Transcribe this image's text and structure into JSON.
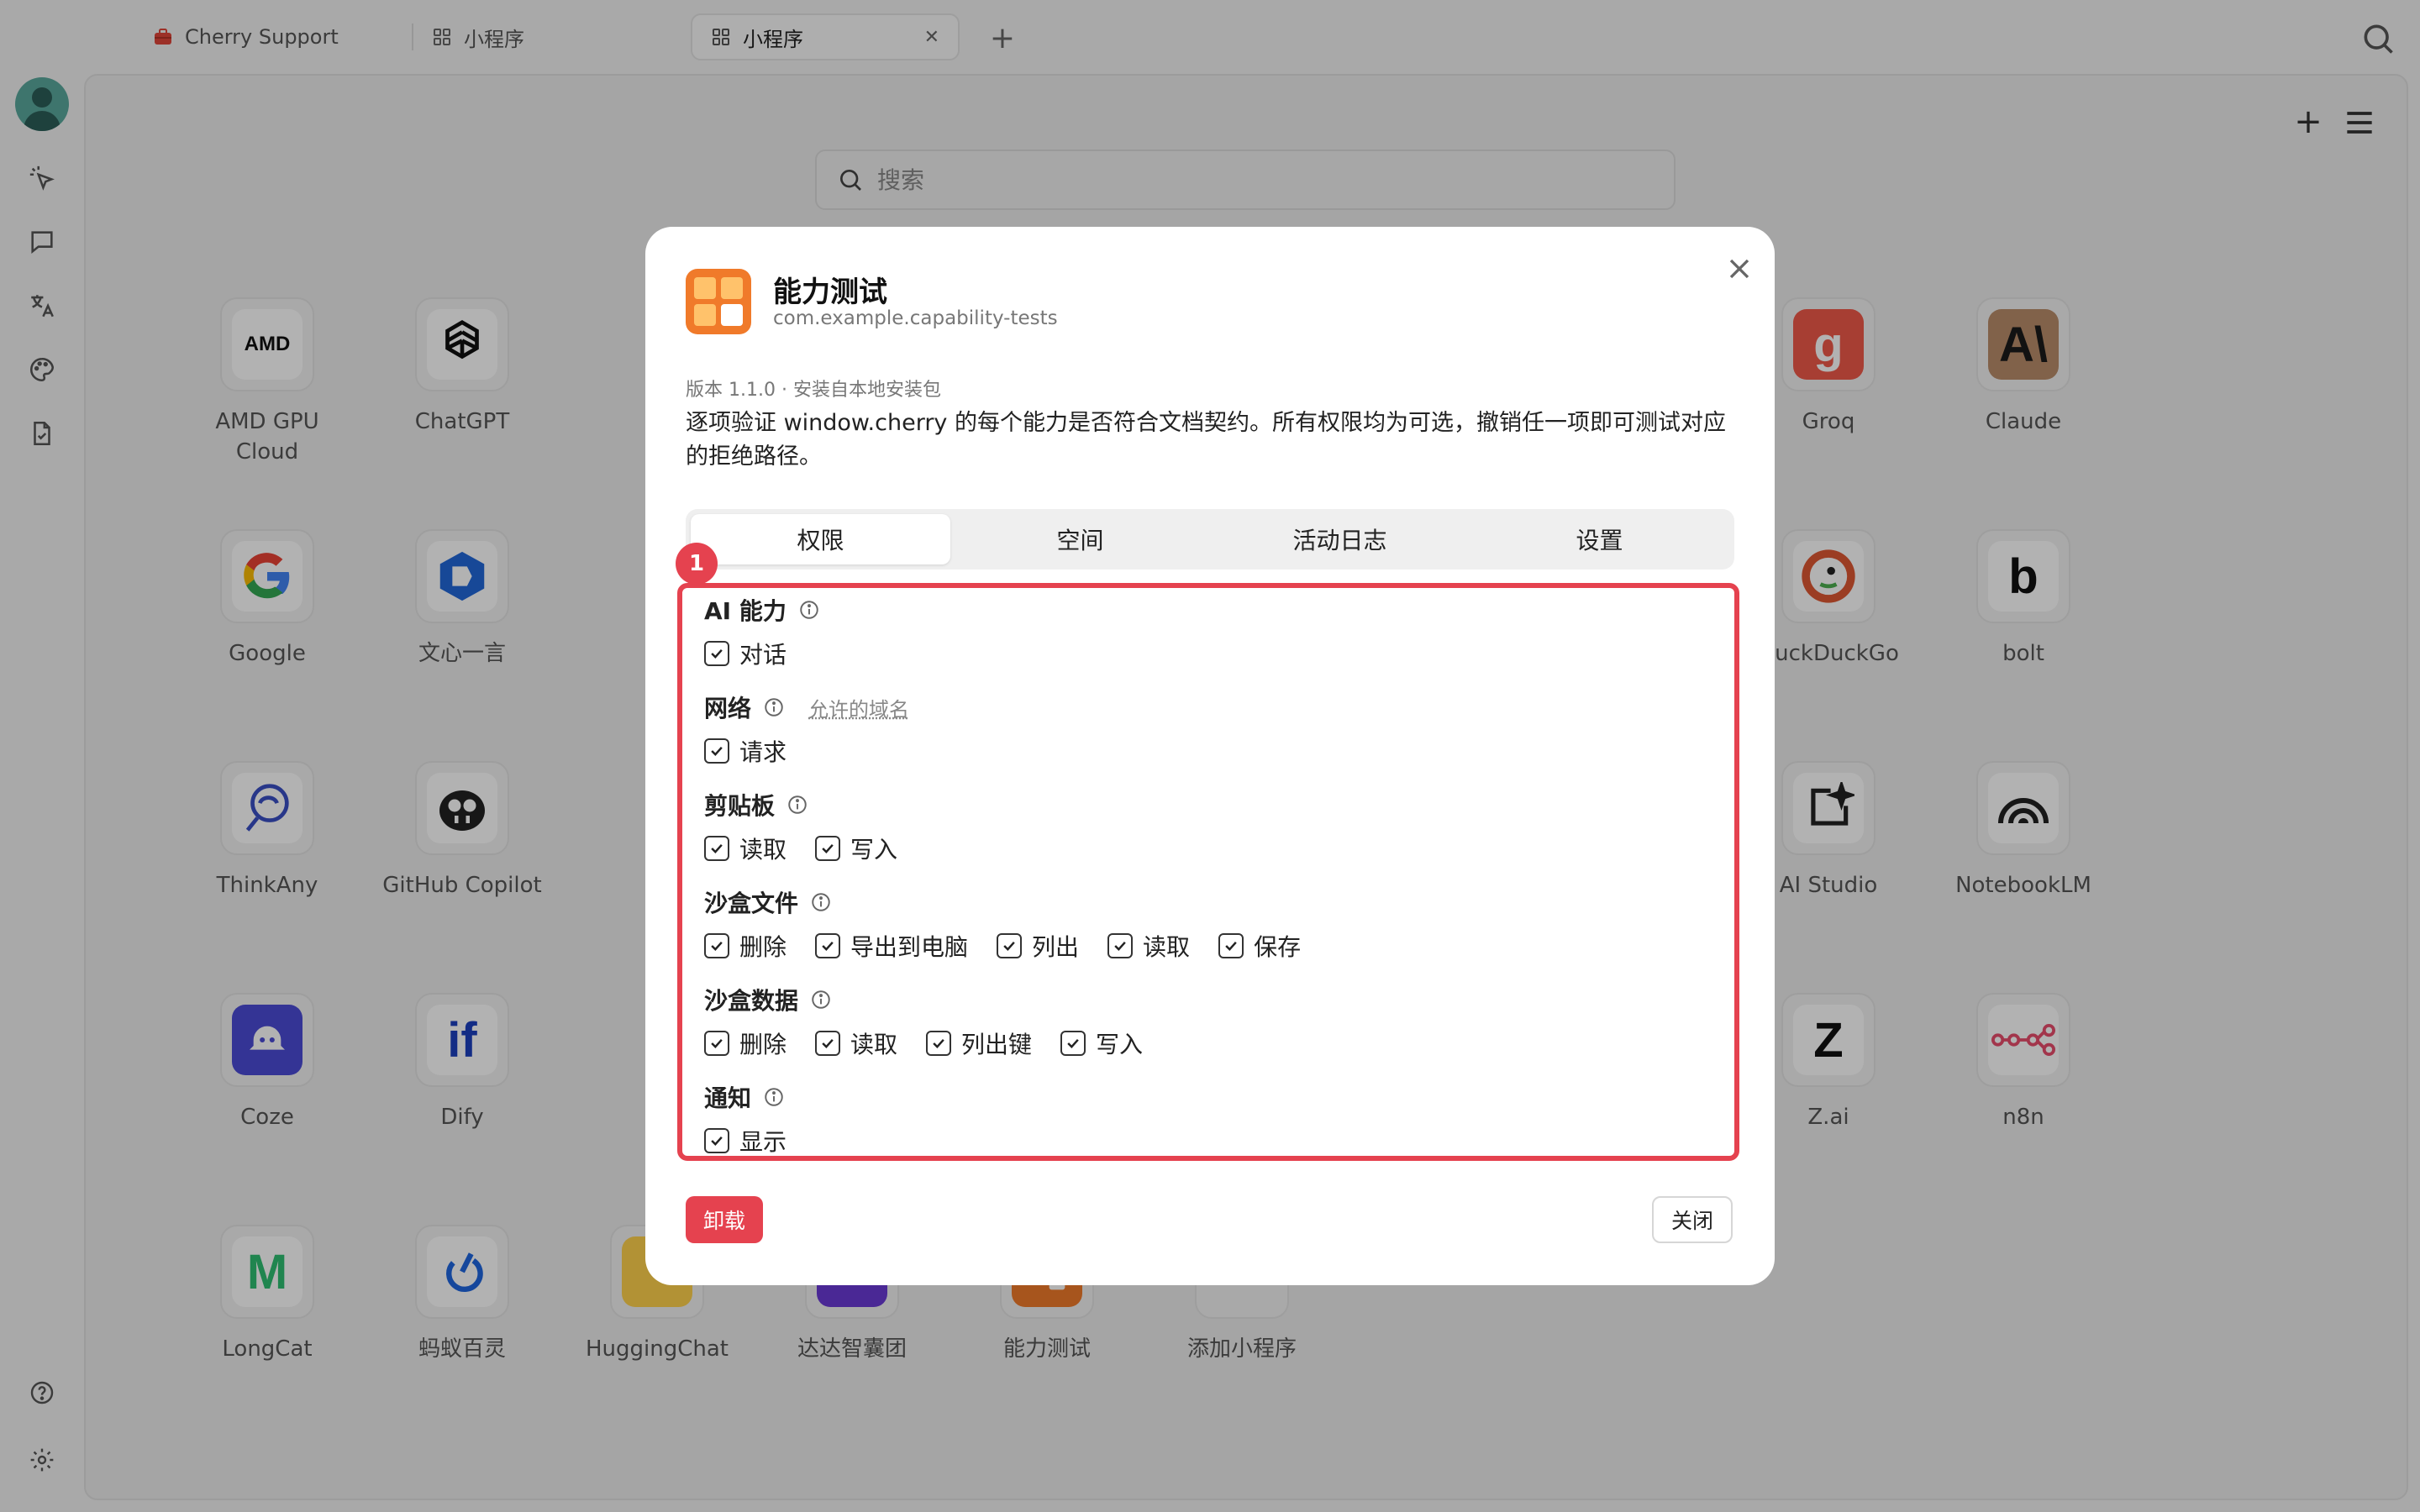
{
  "tabs": [
    {
      "label": "Cherry Support",
      "icon": "briefcase-icon"
    },
    {
      "label": "小程序",
      "icon": "grid-icon"
    },
    {
      "label": "小程序",
      "icon": "grid-icon",
      "active": true
    }
  ],
  "search": {
    "placeholder": "搜索"
  },
  "apps": [
    {
      "name": "AMD GPU Cloud",
      "mark": "AMD",
      "bg": "#ffffff",
      "fg": "#111111"
    },
    {
      "name": "ChatGPT",
      "mark": "",
      "bg": "#ffffff",
      "fg": "#111111"
    },
    {
      "name": "Groq",
      "mark": "g",
      "bg": "#f05a4a",
      "fg": "#ffffff"
    },
    {
      "name": "Claude",
      "mark": "A\\",
      "bg": "#b98d6a",
      "fg": "#1a1a1a"
    },
    {
      "name": "Google",
      "mark": "G",
      "bg": "#ffffff",
      "fg": "#4285f4"
    },
    {
      "name": "文心一言",
      "mark": "",
      "bg": "#ffffff",
      "fg": "#2267d8"
    },
    {
      "name": "DuckDuckGo",
      "mark": "",
      "bg": "#ffffff",
      "fg": "#de5833"
    },
    {
      "name": "bolt",
      "mark": "b",
      "bg": "#ffffff",
      "fg": "#111111"
    },
    {
      "name": "ThinkAny",
      "mark": "",
      "bg": "#ffffff",
      "fg": "#3a4fc4"
    },
    {
      "name": "GitHub Copilot",
      "mark": "",
      "bg": "#ffffff",
      "fg": "#111111"
    },
    {
      "name": "AI Studio",
      "mark": "",
      "bg": "#ffffff",
      "fg": "#111111"
    },
    {
      "name": "NotebookLM",
      "mark": "",
      "bg": "#ffffff",
      "fg": "#111111"
    },
    {
      "name": "Coze",
      "mark": "",
      "bg": "#4b4bd6",
      "fg": "#ffffff"
    },
    {
      "name": "Dify",
      "mark": "if",
      "bg": "#ffffff",
      "fg": "#1c3fbf"
    },
    {
      "name": "Z.ai",
      "mark": "Z",
      "bg": "#ffffff",
      "fg": "#111111"
    },
    {
      "name": "n8n",
      "mark": "",
      "bg": "#ffffff",
      "fg": "#e84c6c"
    },
    {
      "name": "LongCat",
      "mark": "M",
      "bg": "#ffffff",
      "fg": "#2fbf71"
    },
    {
      "name": "蚂蚁百灵",
      "mark": "",
      "bg": "#ffffff",
      "fg": "#1f66e0"
    },
    {
      "name": "HuggingChat",
      "mark": "",
      "bg": "#ffd24d",
      "fg": "#ffffff"
    },
    {
      "name": "达达智囊团",
      "mark": "",
      "bg": "#6a3ad6",
      "fg": "#ffffff"
    },
    {
      "name": "能力测试",
      "mark": "",
      "bg": "#f07a2a",
      "fg": "#ffffff"
    },
    {
      "name": "添加小程序",
      "mark": "+",
      "bg": "#f2f2f2",
      "fg": "#555555"
    }
  ],
  "modal": {
    "title": "能力测试",
    "package": "com.example.capability-tests",
    "version_line": "版本 1.1.0 · 安装自本地安装包",
    "description": "逐项验证 window.cherry 的每个能力是否符合文档契约。所有权限均为可选，撤销任一项即可测试对应的拒绝路径。",
    "tabs": [
      "权限",
      "空间",
      "活动日志",
      "设置"
    ],
    "active_tab": "权限",
    "badge": "1",
    "groups": [
      {
        "title": "AI 能力",
        "items": [
          "对话"
        ]
      },
      {
        "title": "网络",
        "link": "允许的域名",
        "items": [
          "请求"
        ]
      },
      {
        "title": "剪贴板",
        "items": [
          "读取",
          "写入"
        ]
      },
      {
        "title": "沙盒文件",
        "items": [
          "删除",
          "导出到电脑",
          "列出",
          "读取",
          "保存"
        ]
      },
      {
        "title": "沙盒数据",
        "items": [
          "删除",
          "读取",
          "列出键",
          "写入"
        ]
      },
      {
        "title": "通知",
        "items": [
          "显示"
        ]
      }
    ],
    "uninstall_label": "卸载",
    "close_label": "关闭"
  },
  "colors": {
    "accent_red": "#e5424f",
    "brand_orange": "#f07a2a"
  }
}
